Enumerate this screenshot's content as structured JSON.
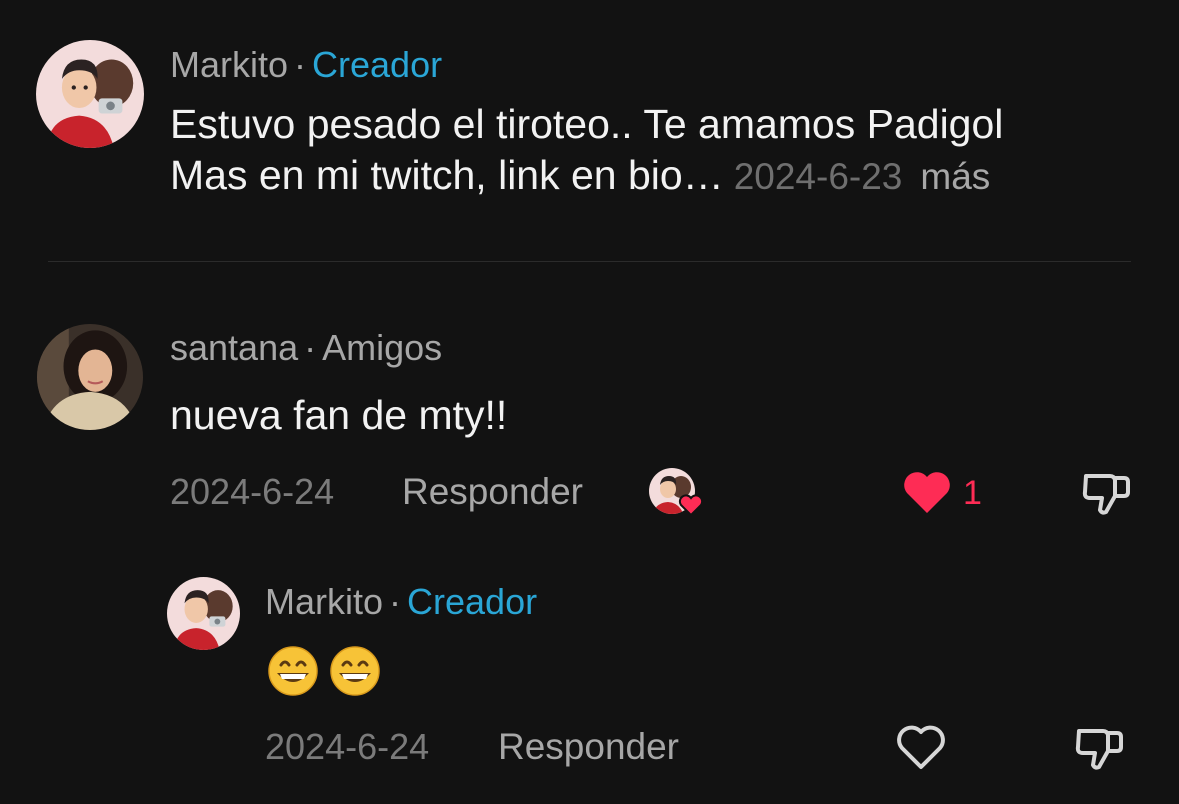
{
  "comment": {
    "author": "Markito",
    "separator": "·",
    "badge": "Creador",
    "line1": "Estuvo pesado el tiroteo.. Te amamos Padigol",
    "line2": "Mas en mi twitch, link en bio…",
    "date": "2024-6-23",
    "more_label": "más"
  },
  "reply1": {
    "author": "santana",
    "separator": "·",
    "badge": "Amigos",
    "text": "nueva fan de mty!!",
    "date": "2024-6-24",
    "reply_label": "Responder",
    "like_count": "1",
    "liked": true
  },
  "reply2": {
    "author": "Markito",
    "separator": "·",
    "badge": "Creador",
    "text": "😁😁",
    "date": "2024-6-24",
    "reply_label": "Responder",
    "liked": false
  },
  "colors": {
    "background": "#121212",
    "creator_badge": "#2aa6d6",
    "like_red": "#fe2c55",
    "muted": "#a7a7a7"
  },
  "icons": [
    "avatar-markito",
    "avatar-santana",
    "creator-liked-avatar",
    "heart-filled-icon",
    "heart-outline-icon",
    "thumbs-down-icon",
    "grinning-emoji"
  ]
}
